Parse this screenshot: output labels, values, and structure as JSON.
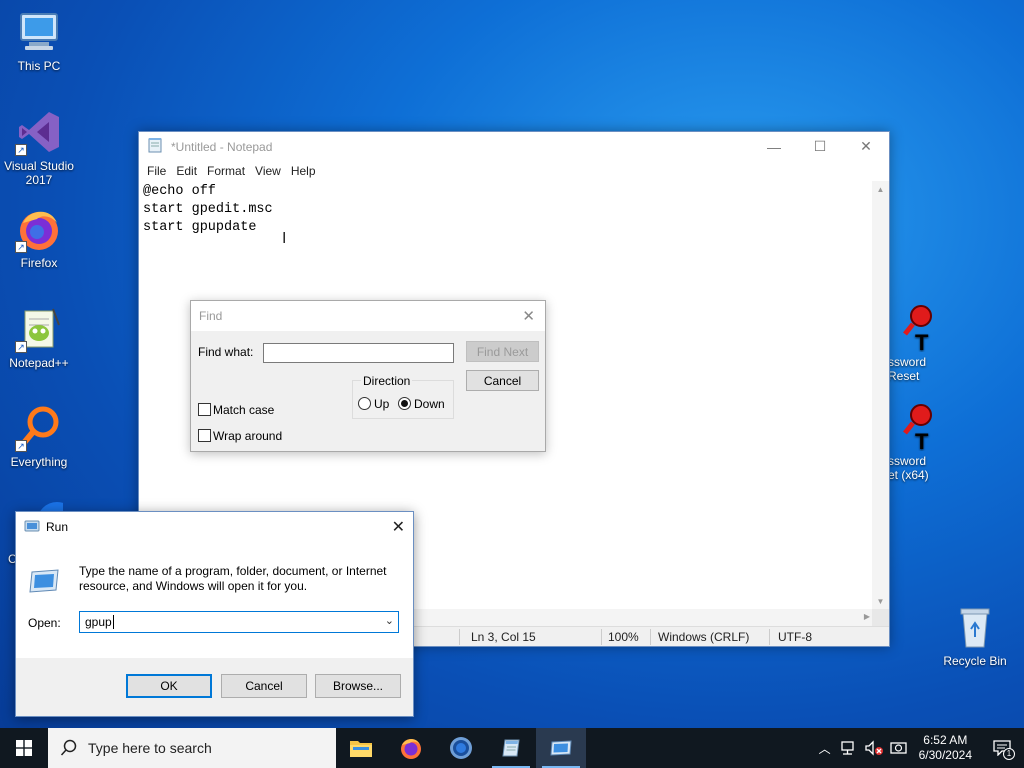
{
  "desktop": {
    "icons": [
      {
        "label": "This PC",
        "icon": "monitor-icon"
      },
      {
        "label": "Visual Studio 2017",
        "icon": "visual-studio-icon"
      },
      {
        "label": "Firefox",
        "icon": "firefox-icon"
      },
      {
        "label": "Notepad++",
        "icon": "notepadpp-icon"
      },
      {
        "label": "Everything",
        "icon": "everything-search-icon"
      },
      {
        "label": "C",
        "icon": "chrome-icon"
      },
      {
        "label": "ssword\nReset",
        "icon": "password-reset-icon"
      },
      {
        "label": "ssword\net (x64)",
        "icon": "password-reset-x64-icon"
      },
      {
        "label": "Recycle Bin",
        "icon": "recycle-bin-icon"
      }
    ]
  },
  "notepad": {
    "title": "*Untitled - Notepad",
    "menu": [
      "File",
      "Edit",
      "Format",
      "View",
      "Help"
    ],
    "content": "@echo off\nstart gpedit.msc\nstart gpupdate",
    "status": {
      "position": "Ln 3, Col 15",
      "zoom": "100%",
      "line_ending": "Windows (CRLF)",
      "encoding": "UTF-8"
    }
  },
  "find_dialog": {
    "title": "Find",
    "find_what_label": "Find what:",
    "find_what_value": "",
    "find_next_label": "Find Next",
    "cancel_label": "Cancel",
    "direction_label": "Direction",
    "up_label": "Up",
    "down_label": "Down",
    "direction_selected": "Down",
    "match_case_label": "Match case",
    "wrap_around_label": "Wrap around"
  },
  "run_dialog": {
    "title": "Run",
    "description": "Type the name of a program, folder, document, or Internet resource, and Windows will open it for you.",
    "open_label": "Open:",
    "open_value": "gpup",
    "ok_label": "OK",
    "cancel_label": "Cancel",
    "browse_label": "Browse..."
  },
  "taskbar": {
    "search_placeholder": "Type here to search",
    "apps": [
      "file-explorer-icon",
      "firefox-icon",
      "chrome-icon",
      "notepad-icon",
      "run-icon"
    ],
    "clock_time": "6:52 AM",
    "clock_date": "6/30/2024",
    "notification_count": "1"
  }
}
